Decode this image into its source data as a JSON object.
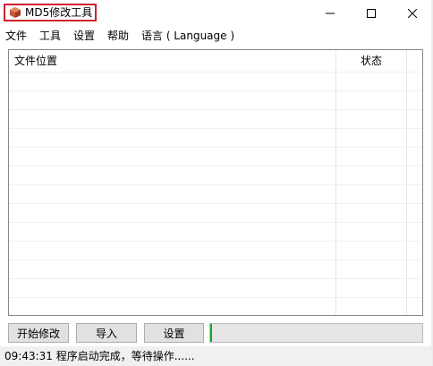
{
  "window": {
    "title": "MD5修改工具",
    "controls": {
      "minimize": "minimize",
      "maximize": "maximize",
      "close": "close"
    }
  },
  "menu": {
    "items": [
      "文件",
      "工具",
      "设置",
      "帮助",
      "语言 ( Language )"
    ]
  },
  "list": {
    "columns": [
      "文件位置",
      "状态"
    ],
    "rows": []
  },
  "toolbar": {
    "start_label": "开始修改",
    "import_label": "导入",
    "settings_label": "设置"
  },
  "progress": {
    "value_percent": 1,
    "color": "#06b025"
  },
  "status": {
    "text": "09:43:31 程序启动完成，等待操作......"
  },
  "colors": {
    "title_highlight": "#d0202c",
    "icon": "#c8553d"
  }
}
